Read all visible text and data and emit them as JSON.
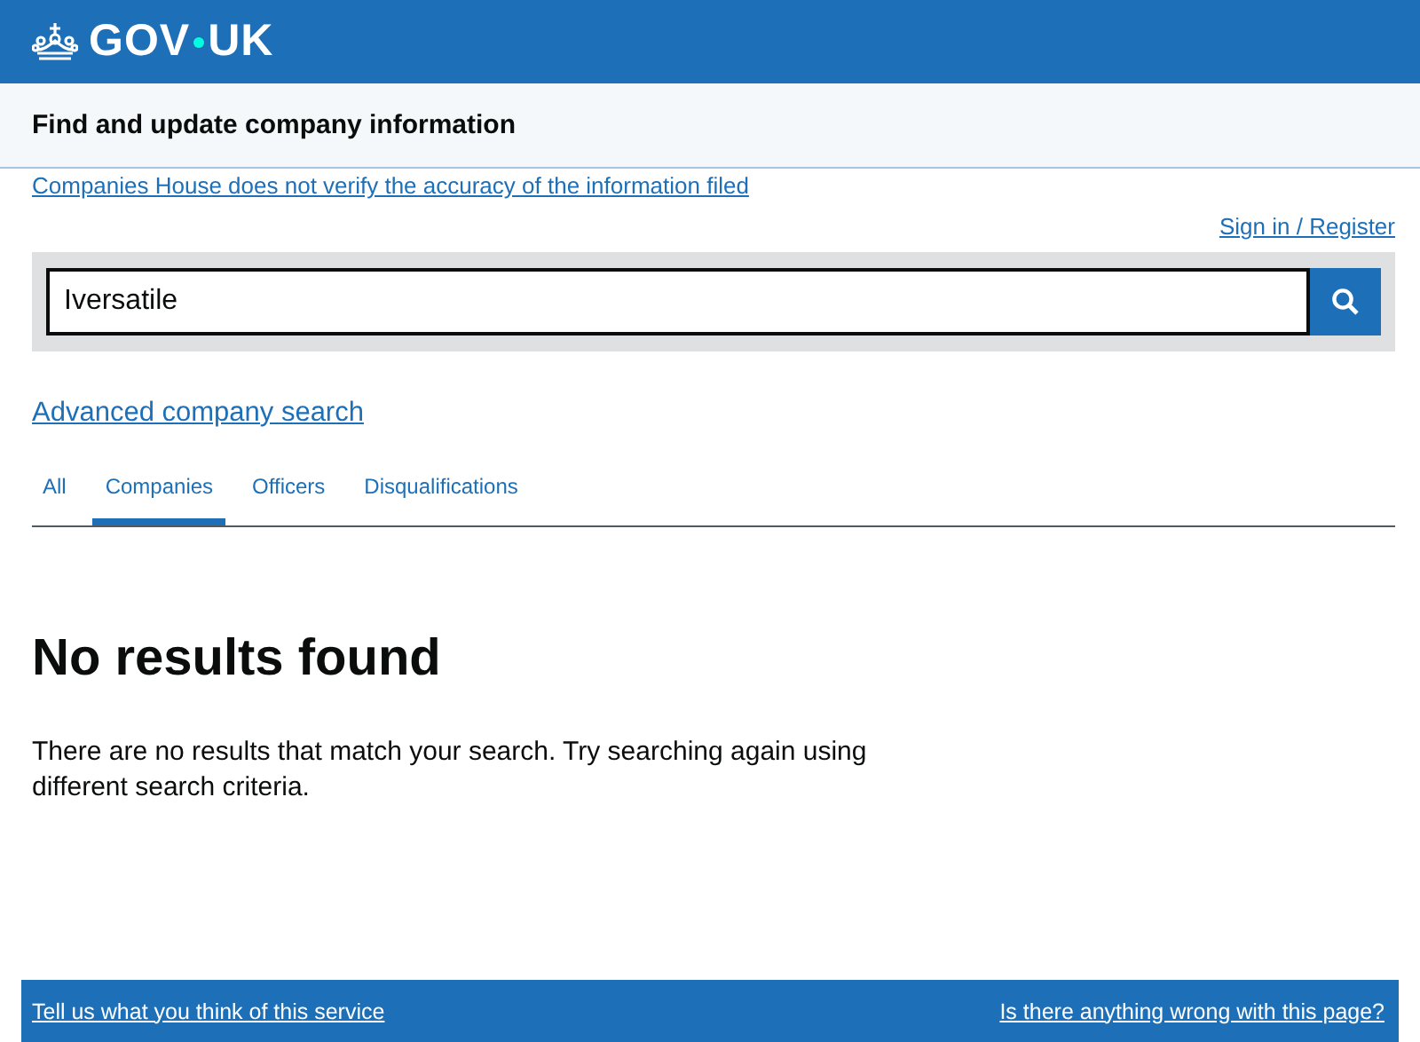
{
  "header": {
    "logo_left": "GOV",
    "logo_right": "UK"
  },
  "service_name": "Find and update company information",
  "notice_link": "Companies House does not verify the accuracy of the information filed",
  "sign_in": "Sign in / Register",
  "search": {
    "value": "Iversatile"
  },
  "advanced_link": "Advanced company search",
  "tabs": [
    {
      "label": "All",
      "selected": false
    },
    {
      "label": "Companies",
      "selected": true
    },
    {
      "label": "Officers",
      "selected": false
    },
    {
      "label": "Disqualifications",
      "selected": false
    }
  ],
  "heading": "No results found",
  "message": "There are no results that match your search. Try searching again using different search criteria.",
  "footer": {
    "feedback": "Tell us what you think of this service",
    "report": "Is there anything wrong with this page?"
  }
}
